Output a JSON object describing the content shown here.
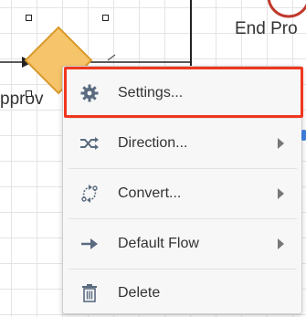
{
  "canvas": {
    "end_label": "End Pro",
    "task_label": "pprov"
  },
  "menu": {
    "items": [
      {
        "label": "Settings...",
        "icon": "gear-icon",
        "submenu": false,
        "highlighted": true
      },
      {
        "label": "Direction...",
        "icon": "shuffle-icon",
        "submenu": true
      },
      {
        "label": "Convert...",
        "icon": "convert-icon",
        "submenu": true
      },
      {
        "label": "Default Flow",
        "icon": "arrow-right-icon",
        "submenu": true
      },
      {
        "label": "Delete",
        "icon": "trash-icon",
        "submenu": false
      }
    ]
  },
  "colors": {
    "highlight": "#f0371e",
    "gateway_fill": "#f6c46a",
    "gateway_stroke": "#d99a2b",
    "end_event": "#c0392b",
    "icon": "#5a6b80",
    "accent_blue": "#3c7bd6"
  }
}
